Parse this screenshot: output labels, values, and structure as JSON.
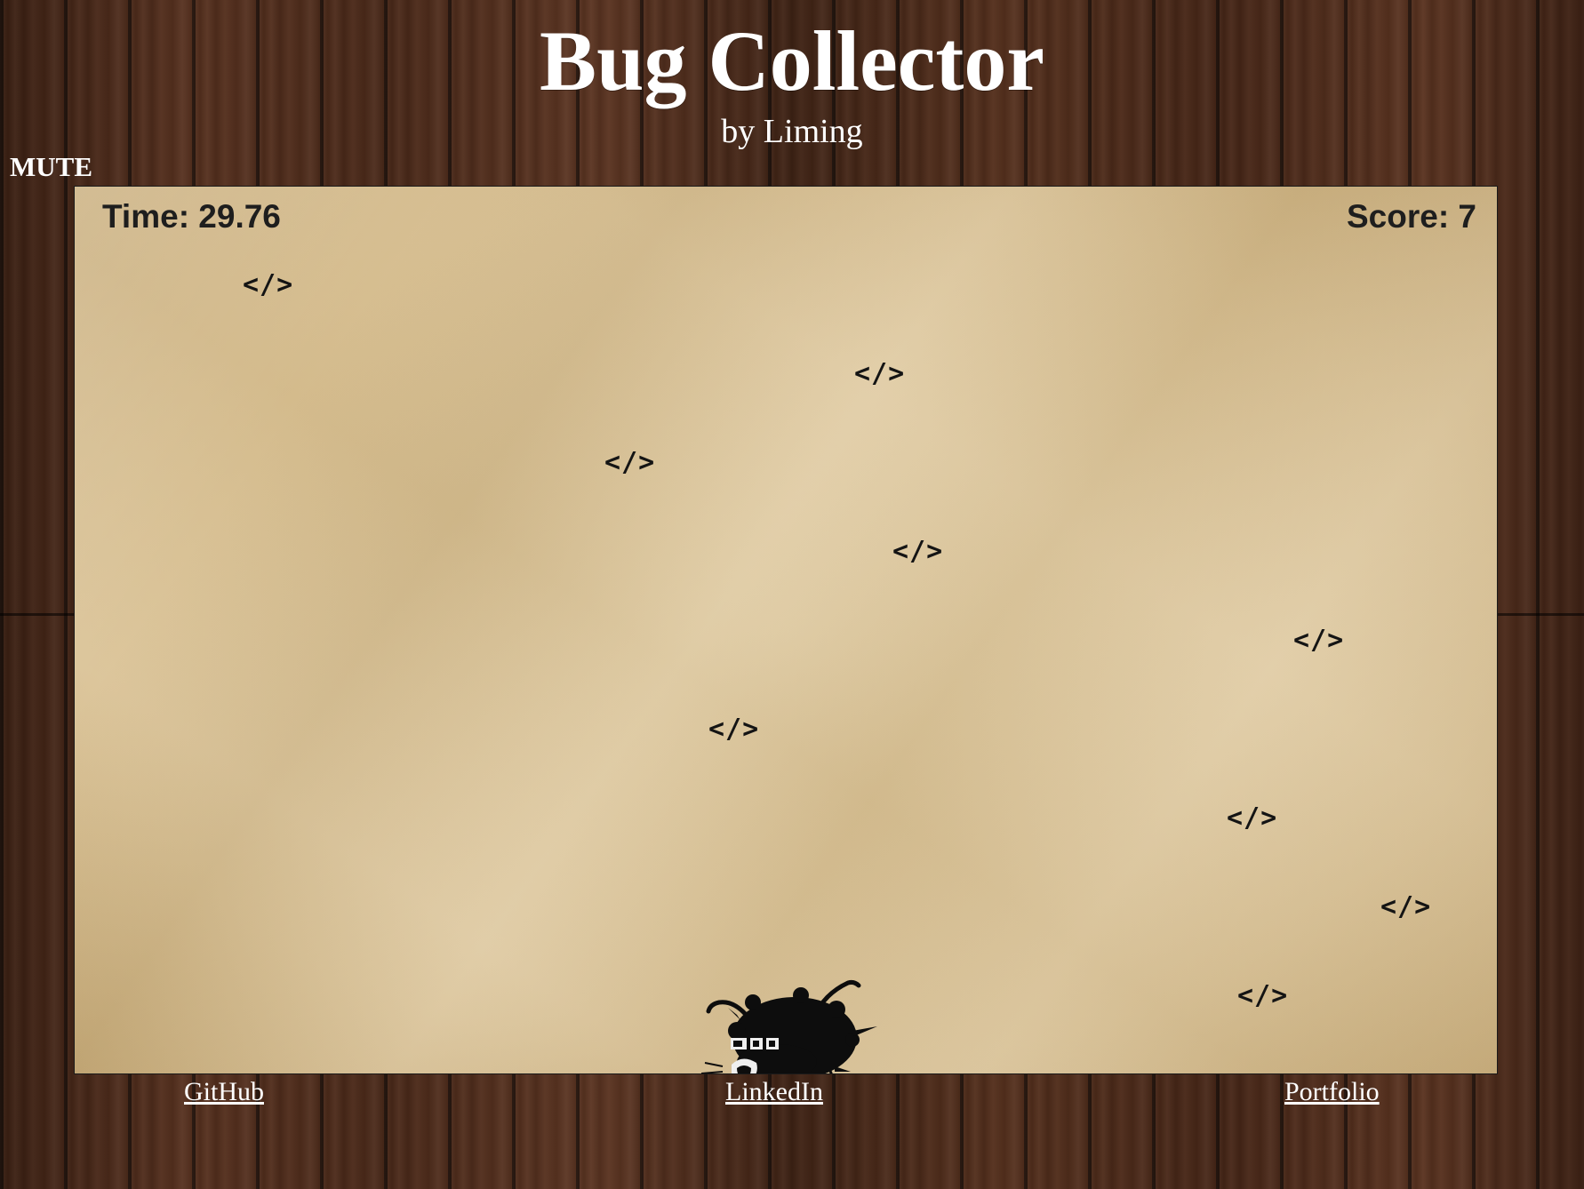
{
  "header": {
    "title": "Bug Collector",
    "subtitle": "by Liming"
  },
  "controls": {
    "mute_label": "MUTE"
  },
  "game": {
    "time_text": "Time: 29.76",
    "score_text": "Score: 7",
    "time_seconds": 29.76,
    "score": 7,
    "bug_glyph": "</>",
    "bug_count": 10,
    "player_icon": "fuzzy-bug-monster-icon"
  },
  "footer": {
    "links": [
      {
        "label": "GitHub"
      },
      {
        "label": "LinkedIn"
      },
      {
        "label": "Portfolio"
      }
    ]
  },
  "colors": {
    "text": "#ffffff",
    "paper": "#dcc497",
    "ink": "#141414",
    "wood": "#4a2a1a"
  }
}
